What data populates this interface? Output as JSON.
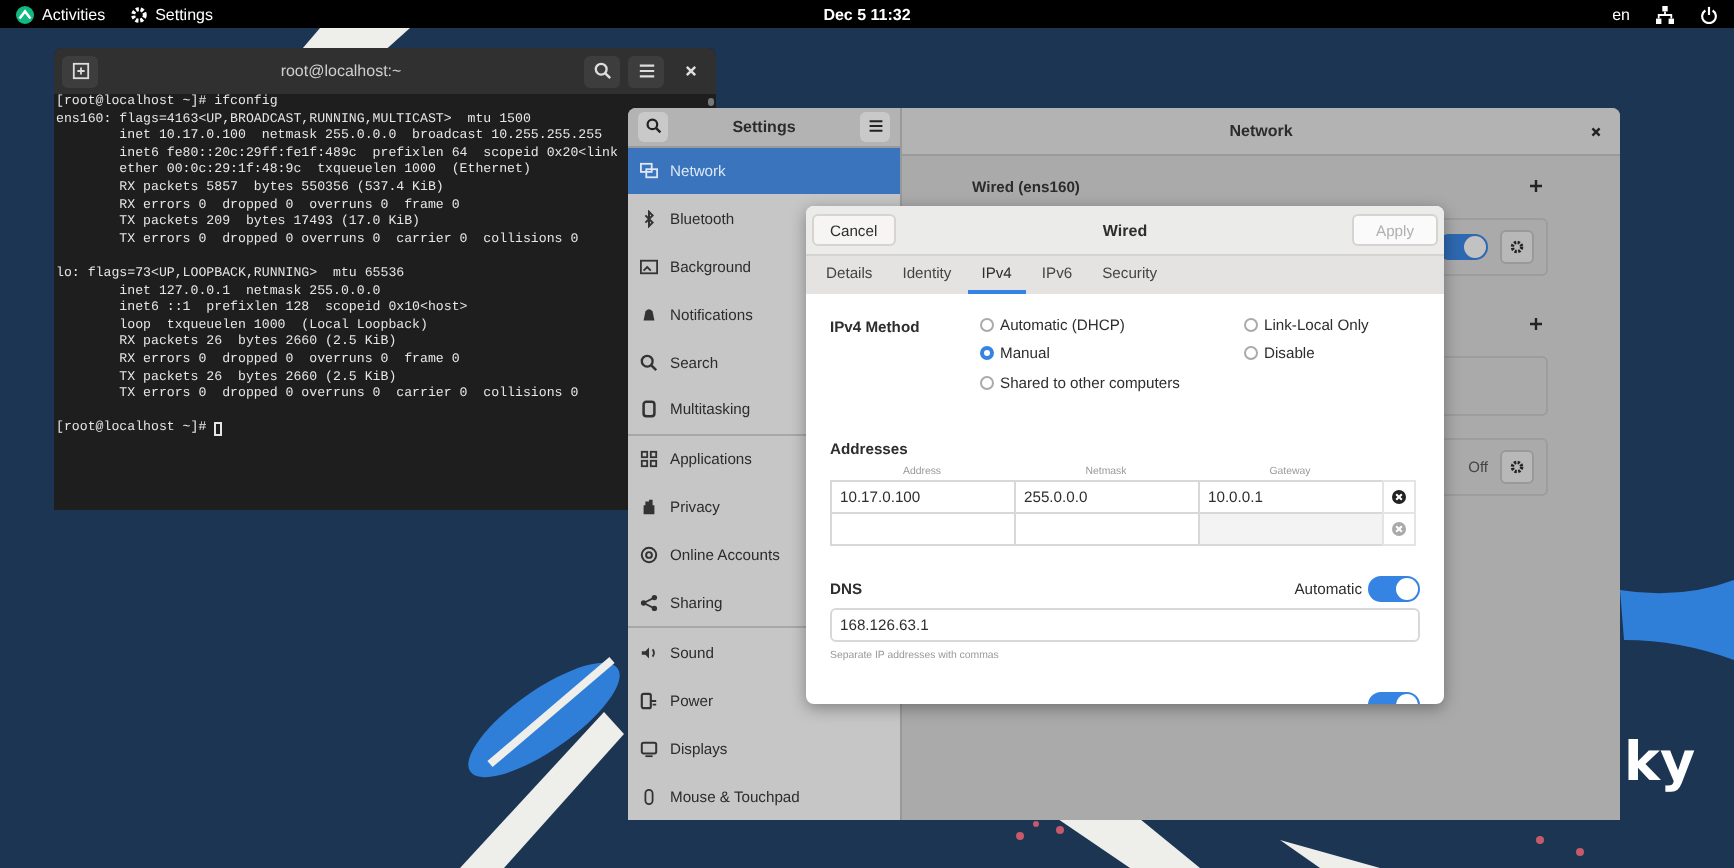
{
  "top_bar": {
    "activities": "Activities",
    "app_name": "Settings",
    "clock": "Dec 5  11:32",
    "keyboard_layout": "en"
  },
  "wallpaper_text": "ky",
  "terminal": {
    "title": "root@localhost:~",
    "blocks": [
      [
        "[root@localhost ~]# ifconfig",
        "ens160: flags=4163<UP,BROADCAST,RUNNING,MULTICAST>  mtu 1500",
        "        inet 10.17.0.100  netmask 255.0.0.0  broadcast 10.255.255.255",
        "        inet6 fe80::20c:29ff:fe1f:489c  prefixlen 64  scopeid 0x20<link",
        "        ether 00:0c:29:1f:48:9c  txqueuelen 1000  (Ethernet)",
        "        RX packets 5857  bytes 550356 (537.4 KiB)",
        "        RX errors 0  dropped 0  overruns 0  frame 0",
        "        TX packets 209  bytes 17493 (17.0 KiB)",
        "        TX errors 0  dropped 0 overruns 0  carrier 0  collisions 0"
      ],
      [
        "lo: flags=73<UP,LOOPBACK,RUNNING>  mtu 65536",
        "        inet 127.0.0.1  netmask 255.0.0.0",
        "        inet6 ::1  prefixlen 128  scopeid 0x10<host>",
        "        loop  txqueuelen 1000  (Local Loopback)",
        "        RX packets 26  bytes 2660 (2.5 KiB)",
        "        RX errors 0  dropped 0  overruns 0  frame 0",
        "        TX packets 26  bytes 2660 (2.5 KiB)",
        "        TX errors 0  dropped 0 overruns 0  carrier 0  collisions 0"
      ],
      [
        "[root@localhost ~]# "
      ]
    ]
  },
  "settings": {
    "title": "Settings",
    "page_title": "Network",
    "sidebar": {
      "groups": [
        [
          {
            "label": "Network",
            "selected": true
          },
          {
            "label": "Bluetooth",
            "selected": false
          },
          {
            "label": "Background",
            "selected": false
          },
          {
            "label": "Notifications",
            "selected": false
          },
          {
            "label": "Search",
            "selected": false
          },
          {
            "label": "Multitasking",
            "selected": false
          }
        ],
        [
          {
            "label": "Applications",
            "selected": false
          },
          {
            "label": "Privacy",
            "selected": false
          },
          {
            "label": "Online Accounts",
            "selected": false
          },
          {
            "label": "Sharing",
            "selected": false
          }
        ],
        [
          {
            "label": "Sound",
            "selected": false
          },
          {
            "label": "Power",
            "selected": false
          },
          {
            "label": "Displays",
            "selected": false
          },
          {
            "label": "Mouse & Touchpad",
            "selected": false
          }
        ]
      ]
    },
    "network": {
      "wired_heading": "Wired (ens160)",
      "wired_on": true,
      "vpn_off_label": "Off"
    }
  },
  "dialog": {
    "cancel": "Cancel",
    "title": "Wired",
    "apply": "Apply",
    "apply_disabled": true,
    "tabs": [
      {
        "label": "Details",
        "selected": false
      },
      {
        "label": "Identity",
        "selected": false
      },
      {
        "label": "IPv4",
        "selected": true
      },
      {
        "label": "IPv6",
        "selected": false
      },
      {
        "label": "Security",
        "selected": false
      }
    ],
    "method_label": "IPv4 Method",
    "methods": [
      {
        "label": "Automatic (DHCP)",
        "selected": false
      },
      {
        "label": "Manual",
        "selected": true
      },
      {
        "label": "Shared to other computers",
        "selected": false
      },
      {
        "label": "Link-Local Only",
        "selected": false
      },
      {
        "label": "Disable",
        "selected": false
      }
    ],
    "addresses_label": "Addresses",
    "address_columns": [
      "Address",
      "Netmask",
      "Gateway"
    ],
    "address_rows": [
      {
        "values": [
          "10.17.0.100",
          "255.0.0.0",
          "10.0.0.1"
        ],
        "removable": true,
        "gateway_disabled": false
      },
      {
        "removable": false,
        "gateway_disabled": true
      }
    ],
    "dns_label": "DNS",
    "dns_automatic_label": "Automatic",
    "dns_automatic": true,
    "dns_value": "168.126.63.1",
    "dns_hint": "Separate IP addresses with commas",
    "cut_off_toggle": {
      "on": true
    }
  }
}
